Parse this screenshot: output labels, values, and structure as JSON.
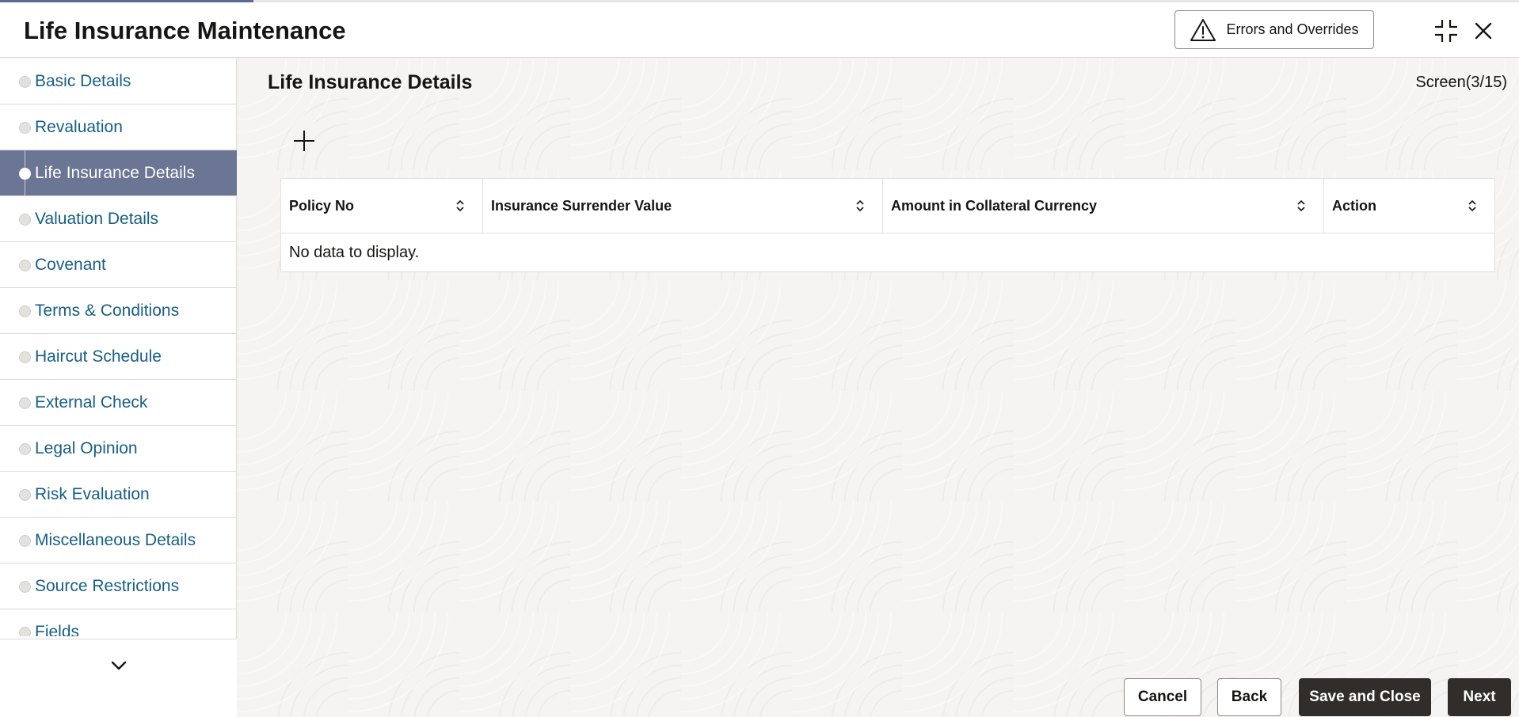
{
  "window": {
    "title": "Life Insurance Maintenance",
    "errors_button_label": "Errors and Overrides",
    "icons": {
      "warning": "warning-triangle-icon",
      "minimize": "collapse-icon",
      "close": "close-icon"
    }
  },
  "sidebar": {
    "items": [
      {
        "label": "Basic Details",
        "active": false
      },
      {
        "label": "Revaluation",
        "active": false
      },
      {
        "label": "Life Insurance Details",
        "active": true
      },
      {
        "label": "Valuation Details",
        "active": false
      },
      {
        "label": "Covenant",
        "active": false
      },
      {
        "label": "Terms & Conditions",
        "active": false
      },
      {
        "label": "Haircut Schedule",
        "active": false
      },
      {
        "label": "External Check",
        "active": false
      },
      {
        "label": "Legal Opinion",
        "active": false
      },
      {
        "label": "Risk Evaluation",
        "active": false
      },
      {
        "label": "Miscellaneous Details",
        "active": false
      },
      {
        "label": "Source Restrictions",
        "active": false
      },
      {
        "label": "Fields",
        "active": false
      }
    ]
  },
  "main": {
    "section_title": "Life Insurance Details",
    "screen_indicator": "Screen(3/15)",
    "table": {
      "columns": [
        "Policy No",
        "Insurance Surrender Value",
        "Amount in Collateral Currency",
        "Action"
      ],
      "empty_message": "No data to display."
    }
  },
  "footer": {
    "cancel_label": "Cancel",
    "back_label": "Back",
    "save_close_label": "Save and Close",
    "next_label": "Next"
  },
  "colors": {
    "active_nav_bg": "#6b7594",
    "nav_link": "#165e84",
    "primary_button": "#312d2a"
  }
}
